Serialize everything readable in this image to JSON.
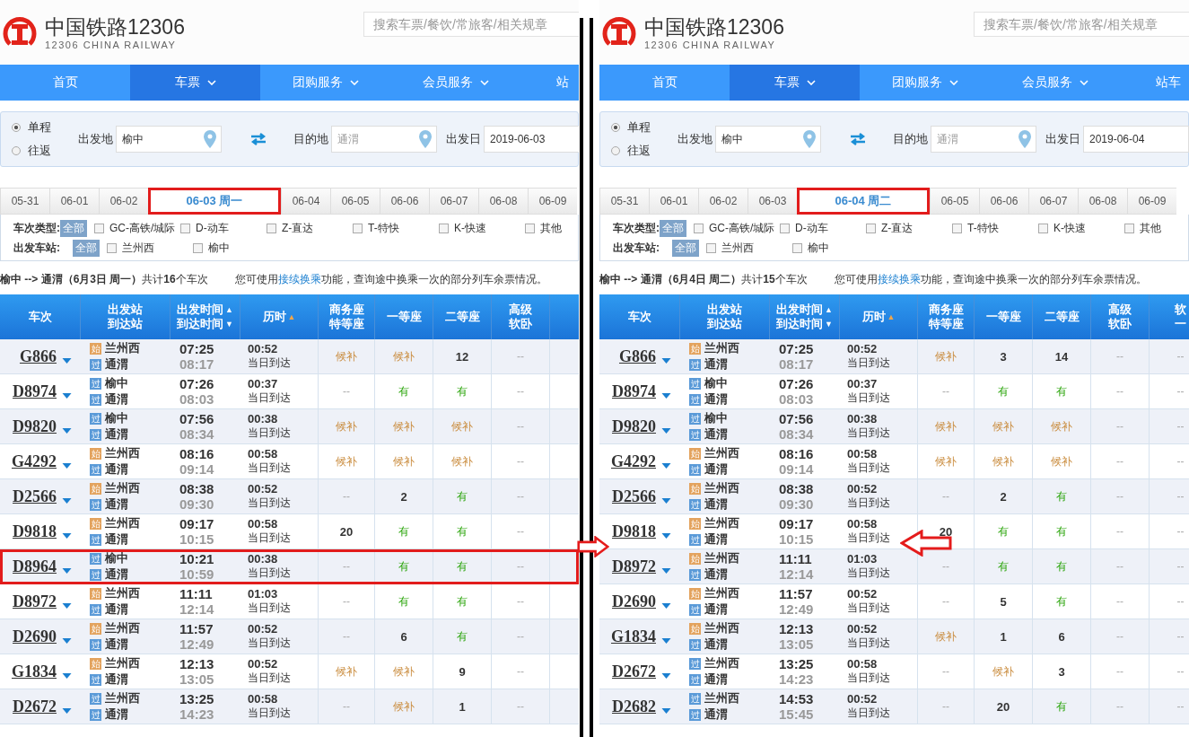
{
  "panels": [
    {
      "logo": {
        "title": "中国铁路12306",
        "subtitle": "12306 CHINA RAILWAY"
      },
      "search": {
        "placeholder": "搜索车票/餐饮/常旅客/相关规章"
      },
      "nav": [
        {
          "label": "首页",
          "selected": false,
          "dropdown": false
        },
        {
          "label": "车票",
          "selected": true,
          "dropdown": true
        },
        {
          "label": "团购服务",
          "selected": false,
          "dropdown": true
        },
        {
          "label": "会员服务",
          "selected": false,
          "dropdown": true
        },
        {
          "label": "站",
          "selected": false,
          "dropdown": false
        }
      ],
      "trip_types": [
        {
          "label": "单程",
          "selected": true
        },
        {
          "label": "往返",
          "selected": false
        }
      ],
      "fields": [
        {
          "label": "出发地",
          "value": "榆中",
          "kind": "place"
        },
        {
          "label": "目的地",
          "placeholder": "通渭",
          "kind": "place"
        },
        {
          "label": "出发日",
          "value": "2019-06-03",
          "kind": "date"
        }
      ],
      "date_tabs": [
        {
          "label": "05-31",
          "selected": false
        },
        {
          "label": "06-01",
          "selected": false
        },
        {
          "label": "06-02",
          "selected": false
        },
        {
          "label": "06-03 周一",
          "selected": true
        },
        {
          "label": "06-04",
          "selected": false
        },
        {
          "label": "06-05",
          "selected": false
        },
        {
          "label": "06-06",
          "selected": false
        },
        {
          "label": "06-07",
          "selected": false
        },
        {
          "label": "06-08",
          "selected": false
        },
        {
          "label": "06-09",
          "selected": false
        }
      ],
      "filters": [
        {
          "label": "车次类型:",
          "all": "全部",
          "options": [
            {
              "label": "GC-高铁/城际",
              "checked": false
            },
            {
              "label": "D-动车",
              "checked": false
            },
            {
              "label": "Z-直达",
              "checked": false
            },
            {
              "label": "T-特快",
              "checked": false
            },
            {
              "label": "K-快速",
              "checked": false
            },
            {
              "label": "其他",
              "checked": false
            }
          ]
        },
        {
          "label": "出发车站:",
          "all": "全部",
          "options": [
            {
              "label": "兰州西",
              "checked": false
            },
            {
              "label": "榆中",
              "checked": false
            }
          ]
        }
      ],
      "summary": "**榆中 --> 通渭（6月3日  周一）**共计**16**个车次",
      "hint": {
        "before": "您可使用",
        "link": "接续换乘",
        "after": "功能，查询途中换乘一次的部分列车余票情况。"
      },
      "columns": [
        {
          "lines": [
            "车次"
          ]
        },
        {
          "lines": [
            "出发站",
            "到达站"
          ]
        },
        {
          "lines": [
            "出发时间",
            "到达时间"
          ],
          "sort": [
            "▲",
            "▼"
          ],
          "sort_active": false
        },
        {
          "lines": [
            "历时"
          ],
          "sort": [
            "▲"
          ],
          "sort_active": true
        },
        {
          "lines": [
            "商务座",
            "特等座"
          ]
        },
        {
          "lines": [
            "一等座"
          ]
        },
        {
          "lines": [
            "二等座"
          ]
        },
        {
          "lines": [
            "高级",
            "软卧"
          ]
        }
      ],
      "rows": [
        {
          "train": "G866",
          "from": {
            "badge": "始",
            "kind": "start",
            "name": "兰州西"
          },
          "to": {
            "badge": "过",
            "kind": "pass",
            "name": "通渭"
          },
          "depart": "07:25",
          "arrive": "08:17",
          "duration": "00:52",
          "day": "当日到达",
          "highlighted": false,
          "seats": [
            {
              "text": "候补",
              "kind": "waitlist"
            },
            {
              "text": "候补",
              "kind": "waitlist"
            },
            {
              "text": "12",
              "kind": "count"
            },
            {
              "text": "--",
              "kind": "none"
            }
          ]
        },
        {
          "train": "D8974",
          "from": {
            "badge": "过",
            "kind": "pass",
            "name": "榆中"
          },
          "to": {
            "badge": "过",
            "kind": "pass",
            "name": "通渭"
          },
          "depart": "07:26",
          "arrive": "08:03",
          "duration": "00:37",
          "day": "当日到达",
          "highlighted": false,
          "seats": [
            {
              "text": "--",
              "kind": "none"
            },
            {
              "text": "有",
              "kind": "available"
            },
            {
              "text": "有",
              "kind": "available"
            },
            {
              "text": "--",
              "kind": "none"
            }
          ]
        },
        {
          "train": "D9820",
          "from": {
            "badge": "过",
            "kind": "pass",
            "name": "榆中"
          },
          "to": {
            "badge": "过",
            "kind": "pass",
            "name": "通渭"
          },
          "depart": "07:56",
          "arrive": "08:34",
          "duration": "00:38",
          "day": "当日到达",
          "highlighted": false,
          "seats": [
            {
              "text": "候补",
              "kind": "waitlist"
            },
            {
              "text": "候补",
              "kind": "waitlist"
            },
            {
              "text": "候补",
              "kind": "waitlist"
            },
            {
              "text": "--",
              "kind": "none"
            }
          ]
        },
        {
          "train": "G4292",
          "from": {
            "badge": "始",
            "kind": "start",
            "name": "兰州西"
          },
          "to": {
            "badge": "过",
            "kind": "pass",
            "name": "通渭"
          },
          "depart": "08:16",
          "arrive": "09:14",
          "duration": "00:58",
          "day": "当日到达",
          "highlighted": false,
          "seats": [
            {
              "text": "候补",
              "kind": "waitlist"
            },
            {
              "text": "候补",
              "kind": "waitlist"
            },
            {
              "text": "候补",
              "kind": "waitlist"
            },
            {
              "text": "--",
              "kind": "none"
            }
          ]
        },
        {
          "train": "D2566",
          "from": {
            "badge": "始",
            "kind": "start",
            "name": "兰州西"
          },
          "to": {
            "badge": "过",
            "kind": "pass",
            "name": "通渭"
          },
          "depart": "08:38",
          "arrive": "09:30",
          "duration": "00:52",
          "day": "当日到达",
          "highlighted": false,
          "seats": [
            {
              "text": "--",
              "kind": "none"
            },
            {
              "text": "2",
              "kind": "count"
            },
            {
              "text": "有",
              "kind": "available"
            },
            {
              "text": "--",
              "kind": "none"
            }
          ]
        },
        {
          "train": "D9818",
          "from": {
            "badge": "始",
            "kind": "start",
            "name": "兰州西"
          },
          "to": {
            "badge": "过",
            "kind": "pass",
            "name": "通渭"
          },
          "depart": "09:17",
          "arrive": "10:15",
          "duration": "00:58",
          "day": "当日到达",
          "highlighted": false,
          "seats": [
            {
              "text": "20",
              "kind": "count"
            },
            {
              "text": "有",
              "kind": "available"
            },
            {
              "text": "有",
              "kind": "available"
            },
            {
              "text": "--",
              "kind": "none"
            }
          ]
        },
        {
          "train": "D8964",
          "from": {
            "badge": "过",
            "kind": "pass",
            "name": "榆中"
          },
          "to": {
            "badge": "过",
            "kind": "pass",
            "name": "通渭"
          },
          "depart": "10:21",
          "arrive": "10:59",
          "duration": "00:38",
          "day": "当日到达",
          "highlighted": true,
          "seats": [
            {
              "text": "--",
              "kind": "none"
            },
            {
              "text": "有",
              "kind": "available"
            },
            {
              "text": "有",
              "kind": "available"
            },
            {
              "text": "--",
              "kind": "none"
            }
          ]
        },
        {
          "train": "D8972",
          "from": {
            "badge": "始",
            "kind": "start",
            "name": "兰州西"
          },
          "to": {
            "badge": "过",
            "kind": "pass",
            "name": "通渭"
          },
          "depart": "11:11",
          "arrive": "12:14",
          "duration": "01:03",
          "day": "当日到达",
          "highlighted": false,
          "seats": [
            {
              "text": "--",
              "kind": "none"
            },
            {
              "text": "有",
              "kind": "available"
            },
            {
              "text": "有",
              "kind": "available"
            },
            {
              "text": "--",
              "kind": "none"
            }
          ]
        },
        {
          "train": "D2690",
          "from": {
            "badge": "始",
            "kind": "start",
            "name": "兰州西"
          },
          "to": {
            "badge": "过",
            "kind": "pass",
            "name": "通渭"
          },
          "depart": "11:57",
          "arrive": "12:49",
          "duration": "00:52",
          "day": "当日到达",
          "highlighted": false,
          "seats": [
            {
              "text": "--",
              "kind": "none"
            },
            {
              "text": "6",
              "kind": "count"
            },
            {
              "text": "有",
              "kind": "available"
            },
            {
              "text": "--",
              "kind": "none"
            }
          ]
        },
        {
          "train": "G1834",
          "from": {
            "badge": "始",
            "kind": "start",
            "name": "兰州西"
          },
          "to": {
            "badge": "过",
            "kind": "pass",
            "name": "通渭"
          },
          "depart": "12:13",
          "arrive": "13:05",
          "duration": "00:52",
          "day": "当日到达",
          "highlighted": false,
          "seats": [
            {
              "text": "候补",
              "kind": "waitlist"
            },
            {
              "text": "候补",
              "kind": "waitlist"
            },
            {
              "text": "9",
              "kind": "count"
            },
            {
              "text": "--",
              "kind": "none"
            }
          ]
        },
        {
          "train": "D2672",
          "from": {
            "badge": "过",
            "kind": "pass",
            "name": "兰州西"
          },
          "to": {
            "badge": "过",
            "kind": "pass",
            "name": "通渭"
          },
          "depart": "13:25",
          "arrive": "14:23",
          "duration": "00:58",
          "day": "当日到达",
          "highlighted": false,
          "seats": [
            {
              "text": "--",
              "kind": "none"
            },
            {
              "text": "候补",
              "kind": "waitlist"
            },
            {
              "text": "1",
              "kind": "count"
            },
            {
              "text": "--",
              "kind": "none"
            }
          ]
        }
      ]
    },
    {
      "logo": {
        "title": "中国铁路12306",
        "subtitle": "12306 CHINA RAILWAY"
      },
      "search": {
        "placeholder": "搜索车票/餐饮/常旅客/相关规章"
      },
      "nav": [
        {
          "label": "首页",
          "selected": false,
          "dropdown": false
        },
        {
          "label": "车票",
          "selected": true,
          "dropdown": true
        },
        {
          "label": "团购服务",
          "selected": false,
          "dropdown": true
        },
        {
          "label": "会员服务",
          "selected": false,
          "dropdown": true
        },
        {
          "label": "站车",
          "selected": false,
          "dropdown": false
        }
      ],
      "trip_types": [
        {
          "label": "单程",
          "selected": true
        },
        {
          "label": "往返",
          "selected": false
        }
      ],
      "fields": [
        {
          "label": "出发地",
          "value": "榆中",
          "kind": "place"
        },
        {
          "label": "目的地",
          "placeholder": "通渭",
          "kind": "place"
        },
        {
          "label": "出发日",
          "value": "2019-06-04",
          "kind": "date"
        }
      ],
      "date_tabs": [
        {
          "label": "05-31",
          "selected": false
        },
        {
          "label": "06-01",
          "selected": false
        },
        {
          "label": "06-02",
          "selected": false
        },
        {
          "label": "06-03",
          "selected": false
        },
        {
          "label": "06-04 周二",
          "selected": true
        },
        {
          "label": "06-05",
          "selected": false
        },
        {
          "label": "06-06",
          "selected": false
        },
        {
          "label": "06-07",
          "selected": false
        },
        {
          "label": "06-08",
          "selected": false
        },
        {
          "label": "06-09",
          "selected": false
        }
      ],
      "filters": [
        {
          "label": "车次类型:",
          "all": "全部",
          "options": [
            {
              "label": "GC-高铁/城际",
              "checked": false
            },
            {
              "label": "D-动车",
              "checked": false
            },
            {
              "label": "Z-直达",
              "checked": false
            },
            {
              "label": "T-特快",
              "checked": false
            },
            {
              "label": "K-快速",
              "checked": false
            },
            {
              "label": "其他",
              "checked": false
            }
          ]
        },
        {
          "label": "出发车站:",
          "all": "全部",
          "options": [
            {
              "label": "兰州西",
              "checked": false
            },
            {
              "label": "榆中",
              "checked": false
            }
          ]
        }
      ],
      "summary": "**榆中 --> 通渭（6月4日  周二）**共计**15**个车次",
      "hint": {
        "before": "您可使用",
        "link": "接续换乘",
        "after": "功能，查询途中换乘一次的部分列车余票情况。"
      },
      "columns": [
        {
          "lines": [
            "车次"
          ]
        },
        {
          "lines": [
            "出发站",
            "到达站"
          ]
        },
        {
          "lines": [
            "出发时间",
            "到达时间"
          ],
          "sort": [
            "▲",
            "▼"
          ],
          "sort_active": false
        },
        {
          "lines": [
            "历时"
          ],
          "sort": [
            "▲"
          ],
          "sort_active": true
        },
        {
          "lines": [
            "商务座",
            "特等座"
          ]
        },
        {
          "lines": [
            "一等座"
          ]
        },
        {
          "lines": [
            "二等座"
          ]
        },
        {
          "lines": [
            "高级",
            "软卧"
          ]
        },
        {
          "lines": [
            "软",
            "一"
          ]
        }
      ],
      "rows": [
        {
          "train": "G866",
          "from": {
            "badge": "始",
            "kind": "start",
            "name": "兰州西"
          },
          "to": {
            "badge": "过",
            "kind": "pass",
            "name": "通渭"
          },
          "depart": "07:25",
          "arrive": "08:17",
          "duration": "00:52",
          "day": "当日到达",
          "highlighted": false,
          "seats": [
            {
              "text": "候补",
              "kind": "waitlist"
            },
            {
              "text": "3",
              "kind": "count"
            },
            {
              "text": "14",
              "kind": "count"
            },
            {
              "text": "--",
              "kind": "none"
            },
            {
              "text": "--",
              "kind": "none"
            }
          ]
        },
        {
          "train": "D8974",
          "from": {
            "badge": "过",
            "kind": "pass",
            "name": "榆中"
          },
          "to": {
            "badge": "过",
            "kind": "pass",
            "name": "通渭"
          },
          "depart": "07:26",
          "arrive": "08:03",
          "duration": "00:37",
          "day": "当日到达",
          "highlighted": false,
          "seats": [
            {
              "text": "--",
              "kind": "none"
            },
            {
              "text": "有",
              "kind": "available"
            },
            {
              "text": "有",
              "kind": "available"
            },
            {
              "text": "--",
              "kind": "none"
            },
            {
              "text": "--",
              "kind": "none"
            }
          ]
        },
        {
          "train": "D9820",
          "from": {
            "badge": "过",
            "kind": "pass",
            "name": "榆中"
          },
          "to": {
            "badge": "过",
            "kind": "pass",
            "name": "通渭"
          },
          "depart": "07:56",
          "arrive": "08:34",
          "duration": "00:38",
          "day": "当日到达",
          "highlighted": false,
          "seats": [
            {
              "text": "候补",
              "kind": "waitlist"
            },
            {
              "text": "候补",
              "kind": "waitlist"
            },
            {
              "text": "候补",
              "kind": "waitlist"
            },
            {
              "text": "--",
              "kind": "none"
            },
            {
              "text": "--",
              "kind": "none"
            }
          ]
        },
        {
          "train": "G4292",
          "from": {
            "badge": "始",
            "kind": "start",
            "name": "兰州西"
          },
          "to": {
            "badge": "过",
            "kind": "pass",
            "name": "通渭"
          },
          "depart": "08:16",
          "arrive": "09:14",
          "duration": "00:58",
          "day": "当日到达",
          "highlighted": false,
          "seats": [
            {
              "text": "候补",
              "kind": "waitlist"
            },
            {
              "text": "候补",
              "kind": "waitlist"
            },
            {
              "text": "候补",
              "kind": "waitlist"
            },
            {
              "text": "--",
              "kind": "none"
            },
            {
              "text": "--",
              "kind": "none"
            }
          ]
        },
        {
          "train": "D2566",
          "from": {
            "badge": "始",
            "kind": "start",
            "name": "兰州西"
          },
          "to": {
            "badge": "过",
            "kind": "pass",
            "name": "通渭"
          },
          "depart": "08:38",
          "arrive": "09:30",
          "duration": "00:52",
          "day": "当日到达",
          "highlighted": false,
          "seats": [
            {
              "text": "--",
              "kind": "none"
            },
            {
              "text": "2",
              "kind": "count"
            },
            {
              "text": "有",
              "kind": "available"
            },
            {
              "text": "--",
              "kind": "none"
            },
            {
              "text": "--",
              "kind": "none"
            }
          ]
        },
        {
          "train": "D9818",
          "from": {
            "badge": "始",
            "kind": "start",
            "name": "兰州西"
          },
          "to": {
            "badge": "过",
            "kind": "pass",
            "name": "通渭"
          },
          "depart": "09:17",
          "arrive": "10:15",
          "duration": "00:58",
          "day": "当日到达",
          "highlighted": false,
          "seats": [
            {
              "text": "20",
              "kind": "count"
            },
            {
              "text": "有",
              "kind": "available"
            },
            {
              "text": "有",
              "kind": "available"
            },
            {
              "text": "--",
              "kind": "none"
            },
            {
              "text": "--",
              "kind": "none"
            }
          ]
        },
        {
          "train": "D8972",
          "from": {
            "badge": "始",
            "kind": "start",
            "name": "兰州西"
          },
          "to": {
            "badge": "过",
            "kind": "pass",
            "name": "通渭"
          },
          "depart": "11:11",
          "arrive": "12:14",
          "duration": "01:03",
          "day": "当日到达",
          "highlighted": false,
          "seats": [
            {
              "text": "--",
              "kind": "none"
            },
            {
              "text": "有",
              "kind": "available"
            },
            {
              "text": "有",
              "kind": "available"
            },
            {
              "text": "--",
              "kind": "none"
            },
            {
              "text": "--",
              "kind": "none"
            }
          ]
        },
        {
          "train": "D2690",
          "from": {
            "badge": "始",
            "kind": "start",
            "name": "兰州西"
          },
          "to": {
            "badge": "过",
            "kind": "pass",
            "name": "通渭"
          },
          "depart": "11:57",
          "arrive": "12:49",
          "duration": "00:52",
          "day": "当日到达",
          "highlighted": false,
          "seats": [
            {
              "text": "--",
              "kind": "none"
            },
            {
              "text": "5",
              "kind": "count"
            },
            {
              "text": "有",
              "kind": "available"
            },
            {
              "text": "--",
              "kind": "none"
            },
            {
              "text": "--",
              "kind": "none"
            }
          ]
        },
        {
          "train": "G1834",
          "from": {
            "badge": "始",
            "kind": "start",
            "name": "兰州西"
          },
          "to": {
            "badge": "过",
            "kind": "pass",
            "name": "通渭"
          },
          "depart": "12:13",
          "arrive": "13:05",
          "duration": "00:52",
          "day": "当日到达",
          "highlighted": false,
          "seats": [
            {
              "text": "候补",
              "kind": "waitlist"
            },
            {
              "text": "1",
              "kind": "count"
            },
            {
              "text": "6",
              "kind": "count"
            },
            {
              "text": "--",
              "kind": "none"
            },
            {
              "text": "--",
              "kind": "none"
            }
          ]
        },
        {
          "train": "D2672",
          "from": {
            "badge": "过",
            "kind": "pass",
            "name": "兰州西"
          },
          "to": {
            "badge": "过",
            "kind": "pass",
            "name": "通渭"
          },
          "depart": "13:25",
          "arrive": "14:23",
          "duration": "00:58",
          "day": "当日到达",
          "highlighted": false,
          "seats": [
            {
              "text": "--",
              "kind": "none"
            },
            {
              "text": "候补",
              "kind": "waitlist"
            },
            {
              "text": "3",
              "kind": "count"
            },
            {
              "text": "--",
              "kind": "none"
            },
            {
              "text": "--",
              "kind": "none"
            }
          ]
        },
        {
          "train": "D2682",
          "from": {
            "badge": "过",
            "kind": "pass",
            "name": "兰州西"
          },
          "to": {
            "badge": "过",
            "kind": "pass",
            "name": "通渭"
          },
          "depart": "14:53",
          "arrive": "15:45",
          "duration": "00:52",
          "day": "当日到达",
          "highlighted": false,
          "seats": [
            {
              "text": "--",
              "kind": "none"
            },
            {
              "text": "20",
              "kind": "count"
            },
            {
              "text": "有",
              "kind": "available"
            },
            {
              "text": "--",
              "kind": "none"
            },
            {
              "text": "--",
              "kind": "none"
            }
          ]
        }
      ]
    }
  ]
}
